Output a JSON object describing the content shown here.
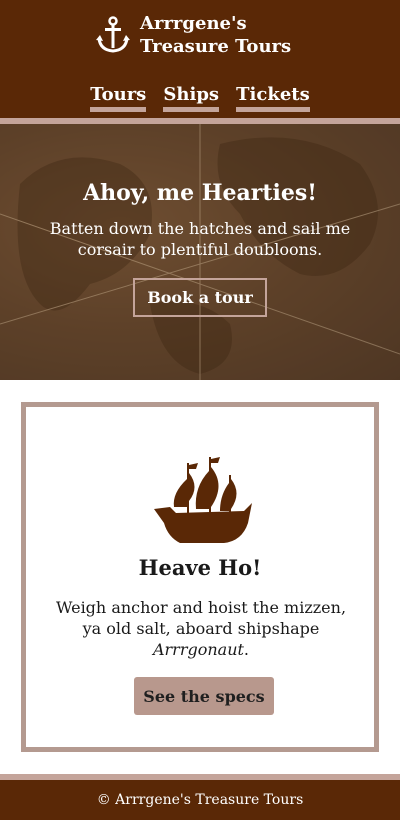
{
  "header": {
    "brand_line1": "Arrrgene's",
    "brand_line2": "Treasure Tours",
    "logo_icon": "anchor-icon",
    "nav": [
      {
        "label": "Tours"
      },
      {
        "label": "Ships"
      },
      {
        "label": "Tickets"
      }
    ]
  },
  "hero": {
    "title": "Ahoy, me Hearties!",
    "text": "Batten down the hatches and sail me corsair to plentiful doubloons.",
    "button_label": "Book a tour"
  },
  "card": {
    "icon": "pirate-ship-icon",
    "title": "Heave Ho!",
    "text_prefix": "Weigh anchor and hoist the mizzen, ya old salt, aboard shipshape ",
    "text_em": "Arrrgonaut",
    "text_suffix": ".",
    "button_label": "See the specs"
  },
  "footer": {
    "text": "© Arrrgene's Treasure Tours"
  },
  "colors": {
    "brand_brown": "#5a2806",
    "accent_tan": "#c4a49a",
    "button_tan": "#b8988d"
  }
}
